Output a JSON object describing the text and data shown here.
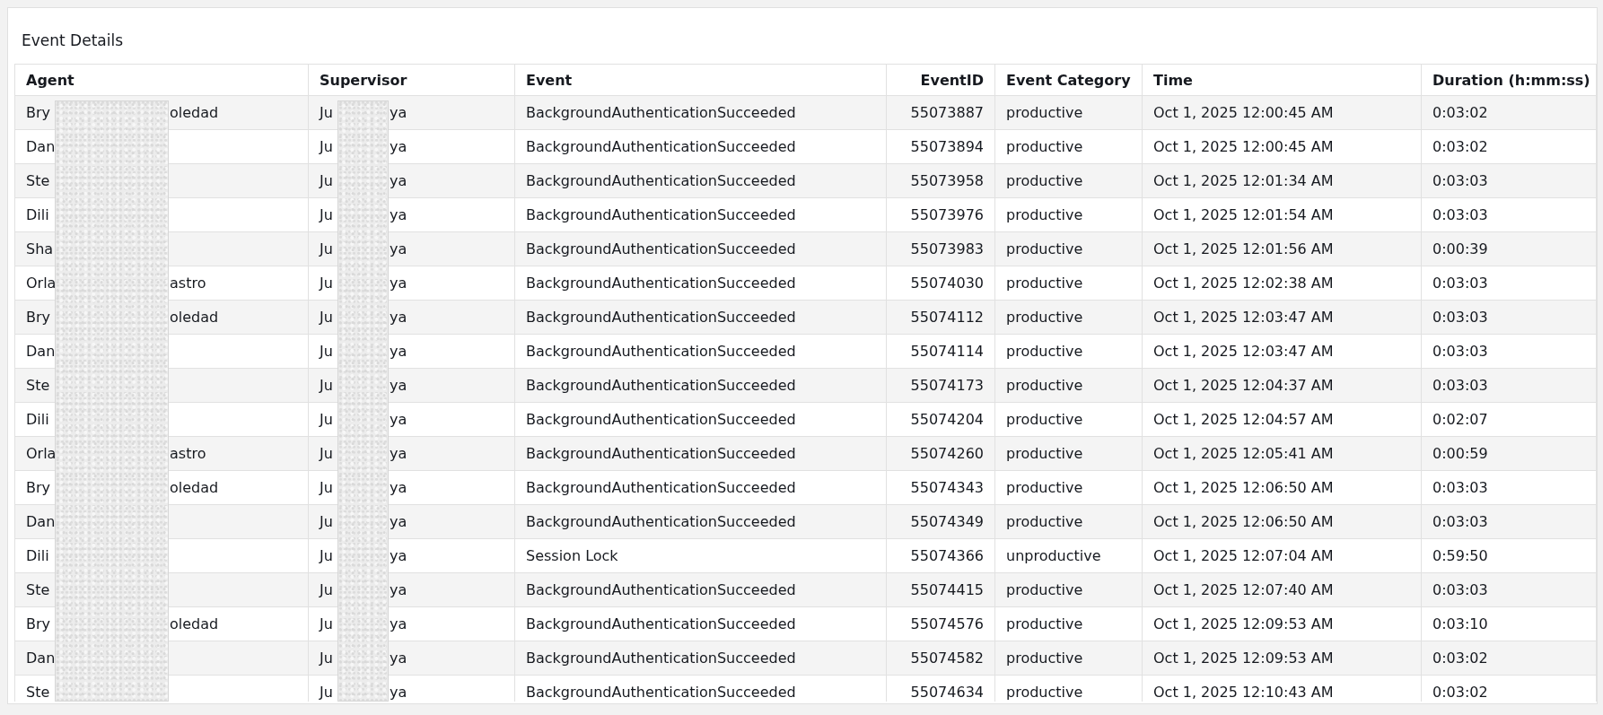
{
  "panel": {
    "title": "Event Details"
  },
  "table": {
    "columns": [
      {
        "label": "Agent",
        "kind": "text",
        "redacted": true
      },
      {
        "label": "Supervisor",
        "kind": "text",
        "redacted": true
      },
      {
        "label": "Event",
        "kind": "text",
        "redacted": false
      },
      {
        "label": "EventID",
        "kind": "number",
        "redacted": false
      },
      {
        "label": "Event Category",
        "kind": "text",
        "redacted": false
      },
      {
        "label": "Time",
        "kind": "text",
        "redacted": false
      },
      {
        "label": "Duration (h:mm:ss)",
        "kind": "text",
        "redacted": false
      }
    ],
    "rows": [
      {
        "agent_start": "Bry",
        "agent_end": "oledad",
        "supervisor_start": "Ju",
        "supervisor_end": "ya",
        "event": "BackgroundAuthenticationSucceeded",
        "event_id": "55073887",
        "category": "productive",
        "time": "Oct 1, 2025 12:00:45 AM",
        "duration": "0:03:02"
      },
      {
        "agent_start": "Dan",
        "supervisor_start": "Ju",
        "supervisor_end": "ya",
        "event": "BackgroundAuthenticationSucceeded",
        "event_id": "55073894",
        "category": "productive",
        "time": "Oct 1, 2025 12:00:45 AM",
        "duration": "0:03:02"
      },
      {
        "agent_start": "Ste",
        "supervisor_start": "Ju",
        "supervisor_end": "ya",
        "event": "BackgroundAuthenticationSucceeded",
        "event_id": "55073958",
        "category": "productive",
        "time": "Oct 1, 2025 12:01:34 AM",
        "duration": "0:03:03"
      },
      {
        "agent_start": "Dili",
        "supervisor_start": "Ju",
        "supervisor_end": "ya",
        "event": "BackgroundAuthenticationSucceeded",
        "event_id": "55073976",
        "category": "productive",
        "time": "Oct 1, 2025 12:01:54 AM",
        "duration": "0:03:03"
      },
      {
        "agent_start": "Sha",
        "supervisor_start": "Ju",
        "supervisor_end": "ya",
        "event": "BackgroundAuthenticationSucceeded",
        "event_id": "55073983",
        "category": "productive",
        "time": "Oct 1, 2025 12:01:56 AM",
        "duration": "0:00:39"
      },
      {
        "agent_start": "Orla",
        "agent_end": "astro",
        "supervisor_start": "Ju",
        "supervisor_end": "ya",
        "event": "BackgroundAuthenticationSucceeded",
        "event_id": "55074030",
        "category": "productive",
        "time": "Oct 1, 2025 12:02:38 AM",
        "duration": "0:03:03"
      },
      {
        "agent_start": "Bry",
        "agent_end": "oledad",
        "supervisor_start": "Ju",
        "supervisor_end": "ya",
        "event": "BackgroundAuthenticationSucceeded",
        "event_id": "55074112",
        "category": "productive",
        "time": "Oct 1, 2025 12:03:47 AM",
        "duration": "0:03:03"
      },
      {
        "agent_start": "Dan",
        "supervisor_start": "Ju",
        "supervisor_end": "ya",
        "event": "BackgroundAuthenticationSucceeded",
        "event_id": "55074114",
        "category": "productive",
        "time": "Oct 1, 2025 12:03:47 AM",
        "duration": "0:03:03"
      },
      {
        "agent_start": "Ste",
        "supervisor_start": "Ju",
        "supervisor_end": "ya",
        "event": "BackgroundAuthenticationSucceeded",
        "event_id": "55074173",
        "category": "productive",
        "time": "Oct 1, 2025 12:04:37 AM",
        "duration": "0:03:03"
      },
      {
        "agent_start": "Dili",
        "supervisor_start": "Ju",
        "supervisor_end": "ya",
        "event": "BackgroundAuthenticationSucceeded",
        "event_id": "55074204",
        "category": "productive",
        "time": "Oct 1, 2025 12:04:57 AM",
        "duration": "0:02:07"
      },
      {
        "agent_start": "Orla",
        "agent_end": "astro",
        "supervisor_start": "Ju",
        "supervisor_end": "ya",
        "event": "BackgroundAuthenticationSucceeded",
        "event_id": "55074260",
        "category": "productive",
        "time": "Oct 1, 2025 12:05:41 AM",
        "duration": "0:00:59"
      },
      {
        "agent_start": "Bry",
        "agent_end": "oledad",
        "supervisor_start": "Ju",
        "supervisor_end": "ya",
        "event": "BackgroundAuthenticationSucceeded",
        "event_id": "55074343",
        "category": "productive",
        "time": "Oct 1, 2025 12:06:50 AM",
        "duration": "0:03:03"
      },
      {
        "agent_start": "Dan",
        "supervisor_start": "Ju",
        "supervisor_end": "ya",
        "event": "BackgroundAuthenticationSucceeded",
        "event_id": "55074349",
        "category": "productive",
        "time": "Oct 1, 2025 12:06:50 AM",
        "duration": "0:03:03"
      },
      {
        "agent_start": "Dili",
        "supervisor_start": "Ju",
        "supervisor_end": "ya",
        "event": "Session Lock",
        "event_id": "55074366",
        "category": "unproductive",
        "time": "Oct 1, 2025 12:07:04 AM",
        "duration": "0:59:50"
      },
      {
        "agent_start": "Ste",
        "supervisor_start": "Ju",
        "supervisor_end": "ya",
        "event": "BackgroundAuthenticationSucceeded",
        "event_id": "55074415",
        "category": "productive",
        "time": "Oct 1, 2025 12:07:40 AM",
        "duration": "0:03:03"
      },
      {
        "agent_start": "Bry",
        "agent_end": "oledad",
        "supervisor_start": "Ju",
        "supervisor_end": "ya",
        "event": "BackgroundAuthenticationSucceeded",
        "event_id": "55074576",
        "category": "productive",
        "time": "Oct 1, 2025 12:09:53 AM",
        "duration": "0:03:10"
      },
      {
        "agent_start": "Dan",
        "supervisor_start": "Ju",
        "supervisor_end": "ya",
        "event": "BackgroundAuthenticationSucceeded",
        "event_id": "55074582",
        "category": "productive",
        "time": "Oct 1, 2025 12:09:53 AM",
        "duration": "0:03:02"
      },
      {
        "agent_start": "Ste",
        "supervisor_start": "Ju",
        "supervisor_end": "ya",
        "event": "BackgroundAuthenticationSucceeded",
        "event_id": "55074634",
        "category": "productive",
        "time": "Oct 1, 2025 12:10:43 AM",
        "duration": "0:03:02"
      }
    ]
  }
}
